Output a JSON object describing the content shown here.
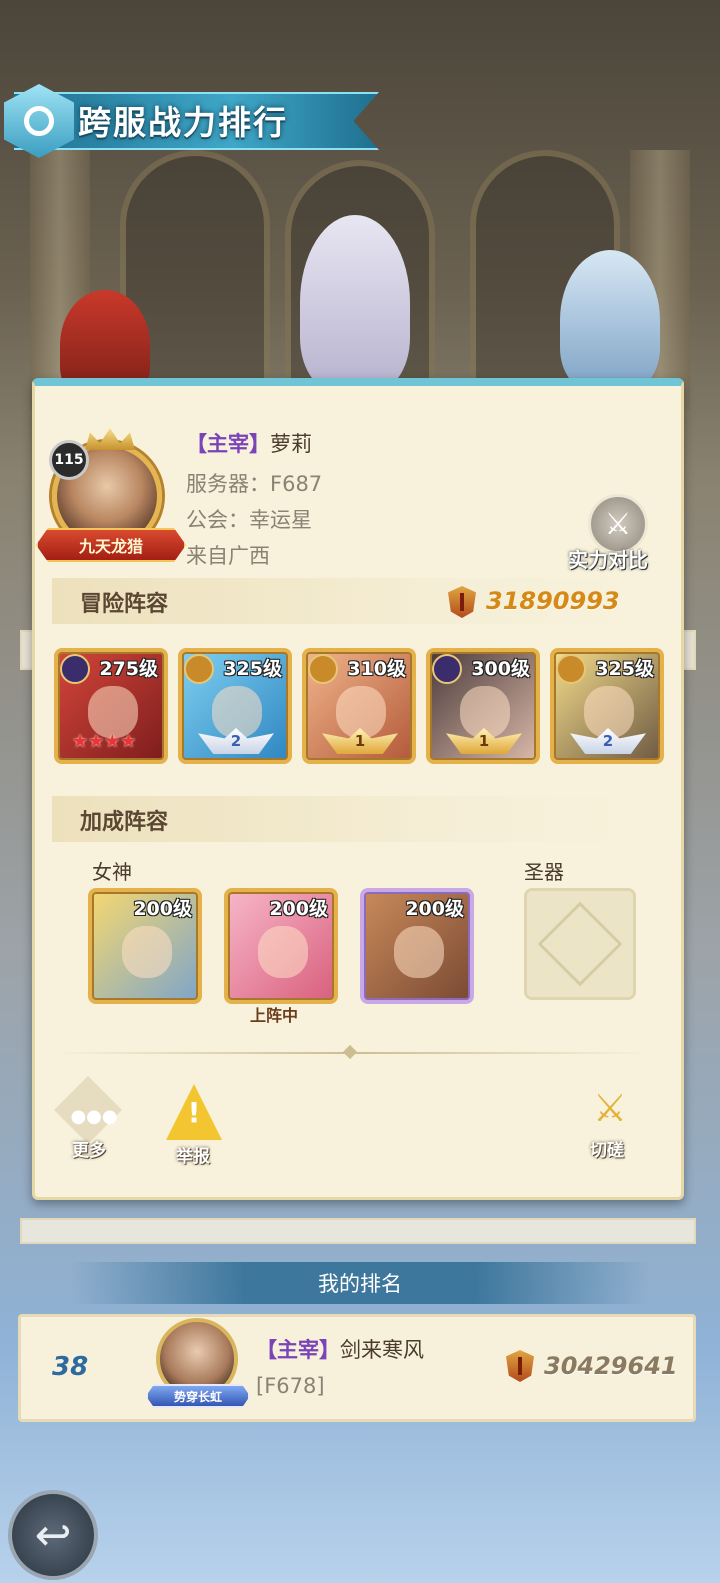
{
  "header": {
    "title": "跨服战力排行"
  },
  "player": {
    "level": "115",
    "title_badge": "九天龙猎",
    "tag": "【主宰】",
    "name": "萝莉",
    "server": "服务器：F687",
    "guild": "公会：幸运星",
    "origin": "来自广西",
    "compare_label": "实力对比"
  },
  "adventure": {
    "title": "冒险阵容",
    "power": "31890993",
    "heroes": [
      {
        "level": "275级",
        "star_text": "★★★★",
        "class": "purple"
      },
      {
        "level": "325级",
        "wing": "2",
        "class": "gold"
      },
      {
        "level": "310级",
        "wing": "1",
        "class": "gold"
      },
      {
        "level": "300级",
        "wing": "1",
        "class": "purple"
      },
      {
        "level": "325级",
        "wing": "2",
        "class": "gold"
      }
    ]
  },
  "bonus": {
    "title": "加成阵容",
    "goddess_label": "女神",
    "artifact_label": "圣器",
    "goddesses": [
      {
        "level": "200级"
      },
      {
        "level": "200级",
        "status": "上阵中"
      },
      {
        "level": "200级"
      }
    ]
  },
  "actions": {
    "more": "更多",
    "report": "举报",
    "spar": "切磋"
  },
  "my_rank": {
    "header": "我的排名",
    "rank": "38",
    "tag": "【主宰】",
    "name": "剑来寒风",
    "server": "[F678]",
    "title_badge": "势穿长虹",
    "power": "30429641"
  },
  "colors": {
    "accent": "#3fa7c7",
    "power": "#d58a17",
    "tag": "#7a44b8"
  }
}
